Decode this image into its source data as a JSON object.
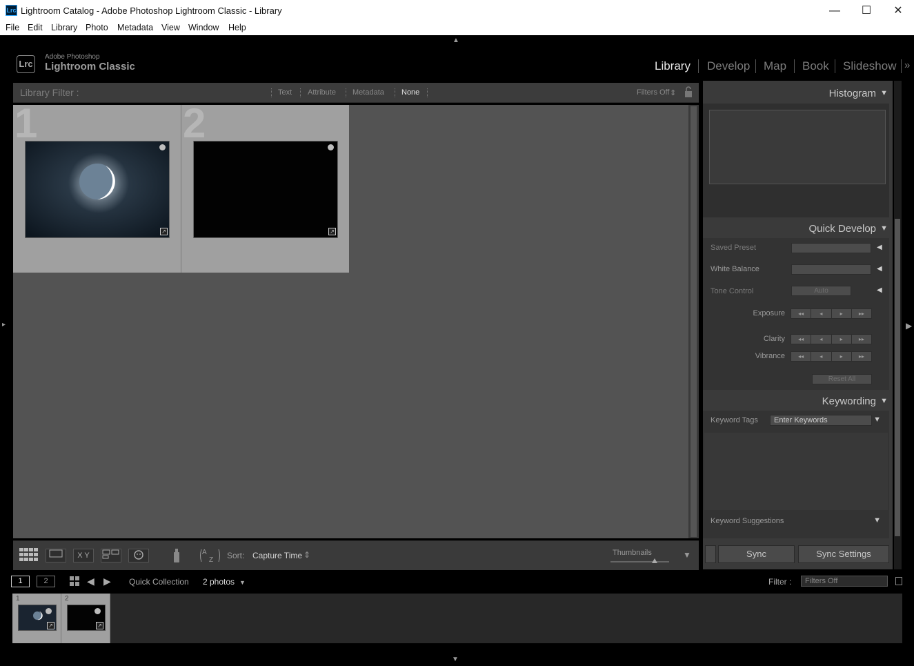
{
  "window": {
    "title": "Lightroom Catalog - Adobe Photoshop Lightroom Classic - Library",
    "app_icon": "Lrc",
    "minimize": "—",
    "maximize": "☐",
    "close": "✕"
  },
  "menu": [
    "File",
    "Edit",
    "Library",
    "Photo",
    "Metadata",
    "View",
    "Window",
    "Help"
  ],
  "identity": {
    "logo": "Lrc",
    "line1": "Adobe Photoshop",
    "line2": "Lightroom Classic"
  },
  "modules": [
    "Library",
    "Develop",
    "Map",
    "Book",
    "Slideshow"
  ],
  "modules_more": "»",
  "active_module": "Library",
  "library_filter": {
    "label": "Library Filter :",
    "items": [
      "Text",
      "Attribute",
      "Metadata",
      "None"
    ],
    "active": "None",
    "filters_off": "Filters Off"
  },
  "grid": {
    "cells": [
      {
        "number": "1",
        "photo": "moon-crescent-bright"
      },
      {
        "number": "2",
        "photo": "moon-crescent-thin"
      }
    ]
  },
  "toolbar": {
    "sort_label": "Sort:",
    "sort_value": "Capture Time",
    "thumbnails_label": "Thumbnails",
    "thumbnails_level": 0.75,
    "compare_label": "X Y"
  },
  "right_panel": {
    "histogram_title": "Histogram",
    "quick_develop_title": "Quick Develop",
    "saved_preset": "Saved Preset",
    "white_balance": "White Balance",
    "tone_control": "Tone Control",
    "auto": "Auto",
    "exposure": "Exposure",
    "clarity": "Clarity",
    "vibrance": "Vibrance",
    "reset_all": "Reset All",
    "stepper_glyphs": [
      "◂◂",
      "◂",
      "▸",
      "▸▸"
    ],
    "keywording_title": "Keywording",
    "keyword_tags": "Keyword Tags",
    "enter_keywords": "Enter Keywords",
    "keyword_suggestions": "Keyword Suggestions",
    "sync": "Sync",
    "sync_settings": "Sync Settings"
  },
  "filmstrip": {
    "page1": "1",
    "page2": "2",
    "source": "Quick Collection",
    "count": "2 photos",
    "filter_label": "Filter :",
    "filter_value": "Filters Off",
    "items": [
      "1",
      "2"
    ]
  }
}
